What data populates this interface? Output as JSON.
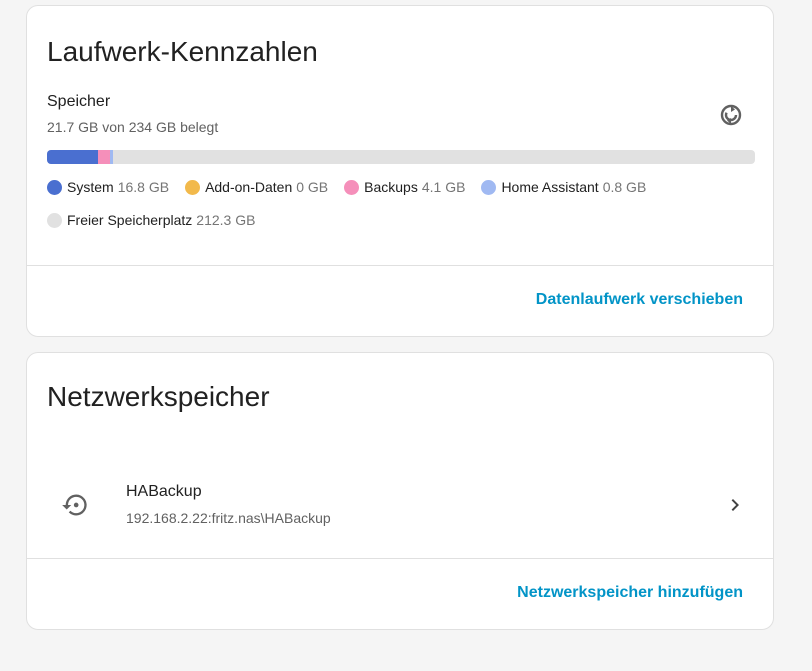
{
  "disk_card": {
    "title": "Laufwerk-Kennzahlen",
    "storage_heading": "Speicher",
    "storage_summary": "21.7 GB von 234 GB belegt",
    "refresh_icon": "refresh-icon",
    "usage_total_gb": 234,
    "legend": [
      {
        "label": "System",
        "value": "16.8 GB",
        "gb": 16.8,
        "color": "#4a6fd0"
      },
      {
        "label": "Add-on-Daten",
        "value": "0 GB",
        "gb": 0,
        "color": "#f2b94b"
      },
      {
        "label": "Backups",
        "value": "4.1 GB",
        "gb": 4.1,
        "color": "#f58fba"
      },
      {
        "label": "Home Assistant",
        "value": "0.8 GB",
        "gb": 0.8,
        "color": "#a0b9f2"
      },
      {
        "label": "Freier Speicherplatz",
        "value": "212.3 GB",
        "gb": 212.3,
        "color": "#e1e1e1"
      }
    ],
    "action": "Datenlaufwerk verschieben"
  },
  "network_card": {
    "title": "Netzwerkspeicher",
    "mounts": [
      {
        "name": "HABackup",
        "path": "192.168.2.22:fritz.nas\\HABackup",
        "icon": "backup-restore-icon"
      }
    ],
    "action": "Netzwerkspeicher hinzufügen"
  },
  "colors": {
    "accent": "#0294c7",
    "card_border": "#e0e0e0",
    "background": "#f5f5f5"
  }
}
